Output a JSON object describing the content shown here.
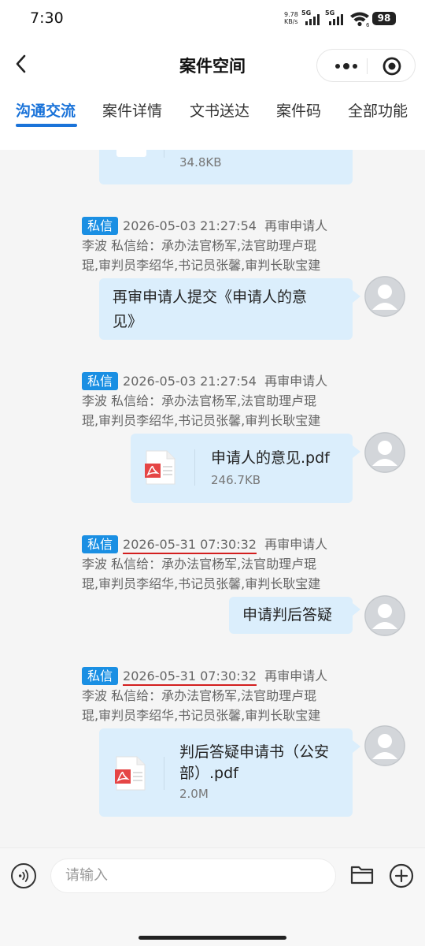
{
  "status_bar": {
    "time": "7:30",
    "net_speed_value": "9.78",
    "net_speed_unit": "KB/s",
    "sim1_label": "5G",
    "sim2_label": "5G",
    "wifi_badge": "6",
    "battery": "98"
  },
  "header": {
    "title": "案件空间",
    "back_icon": "chevron-left-icon",
    "more_icon": "more-dots-icon",
    "target_icon": "target-icon"
  },
  "tabs": [
    {
      "label": "沟通交流",
      "active": true
    },
    {
      "label": "案件详情",
      "active": false
    },
    {
      "label": "文书送达",
      "active": false
    },
    {
      "label": "案件码",
      "active": false
    },
    {
      "label": "全部功能",
      "active": false
    }
  ],
  "messages": {
    "partial_top": {
      "file_size": "34.8KB"
    },
    "items": [
      {
        "badge": "私信",
        "timestamp": "2026-05-03 21:27:54",
        "sender_line_1": "再审申请人",
        "sender_line_2": "李波  私信给：承办法官杨军,法官助理卢琨",
        "sender_line_3": "琨,审判员李绍华,书记员张馨,审判长耿宝建",
        "text_line_1": "再审申请人提交《申请人的意",
        "text_line_2": "见》"
      },
      {
        "badge": "私信",
        "timestamp": "2026-05-03 21:27:54",
        "sender_line_1": "再审申请人",
        "sender_line_2": "李波  私信给：承办法官杨军,法官助理卢琨",
        "sender_line_3": "琨,审判员李绍华,书记员张馨,审判长耿宝建",
        "file_name": "申请人的意见.pdf",
        "file_size": "246.7KB"
      },
      {
        "badge": "私信",
        "timestamp": "2026-05-31 07:30:32",
        "sender_line_1": "再审申请人",
        "sender_line_2": "李波  私信给：承办法官杨军,法官助理卢琨",
        "sender_line_3": "琨,审判员李绍华,书记员张馨,审判长耿宝建",
        "text_line_1": "申请判后答疑"
      },
      {
        "badge": "私信",
        "timestamp": "2026-05-31 07:30:32",
        "sender_line_1": "再审申请人",
        "sender_line_2": "李波  私信给：承办法官杨军,法官助理卢琨",
        "sender_line_3": "琨,审判员李绍华,书记员张馨,审判长耿宝建",
        "file_name_line_1": "判后答疑申请书（公安",
        "file_name_line_2": "部）.pdf",
        "file_size": "2.0M"
      }
    ]
  },
  "input_bar": {
    "placeholder": "请输入",
    "voice_icon": "voice-icon",
    "folder_icon": "folder-icon",
    "plus_icon": "plus-circle-icon"
  },
  "colors": {
    "accent": "#1a73d9",
    "badge": "#1a8fe3",
    "bubble": "#dbeefc",
    "annotation_underline": "#d31f1f"
  }
}
